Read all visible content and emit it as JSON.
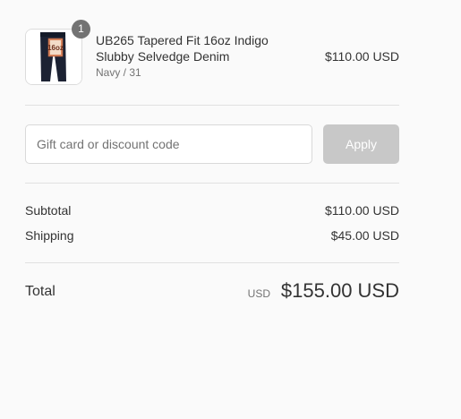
{
  "product": {
    "quantity": "1",
    "name_line1": "UB265 Tapered Fit 16oz Indigo",
    "name_line2": "Slubby Selvedge Denim",
    "variant": "Navy / 31",
    "price": "$110.00 USD",
    "thumbnail_label": "16oz"
  },
  "discount": {
    "placeholder": "Gift card or discount code",
    "value": "",
    "apply_label": "Apply"
  },
  "totals": {
    "subtotal_label": "Subtotal",
    "subtotal_value": "$110.00 USD",
    "shipping_label": "Shipping",
    "shipping_value": "$45.00 USD",
    "total_label": "Total",
    "total_currency": "USD",
    "total_value": "$155.00 USD"
  },
  "colors": {
    "background": "#fafafa",
    "text": "#333333",
    "muted_text": "#737373",
    "apply_button_disabled": "#c8c8c8",
    "divider": "#e1e1e1",
    "badge": "#737373"
  }
}
